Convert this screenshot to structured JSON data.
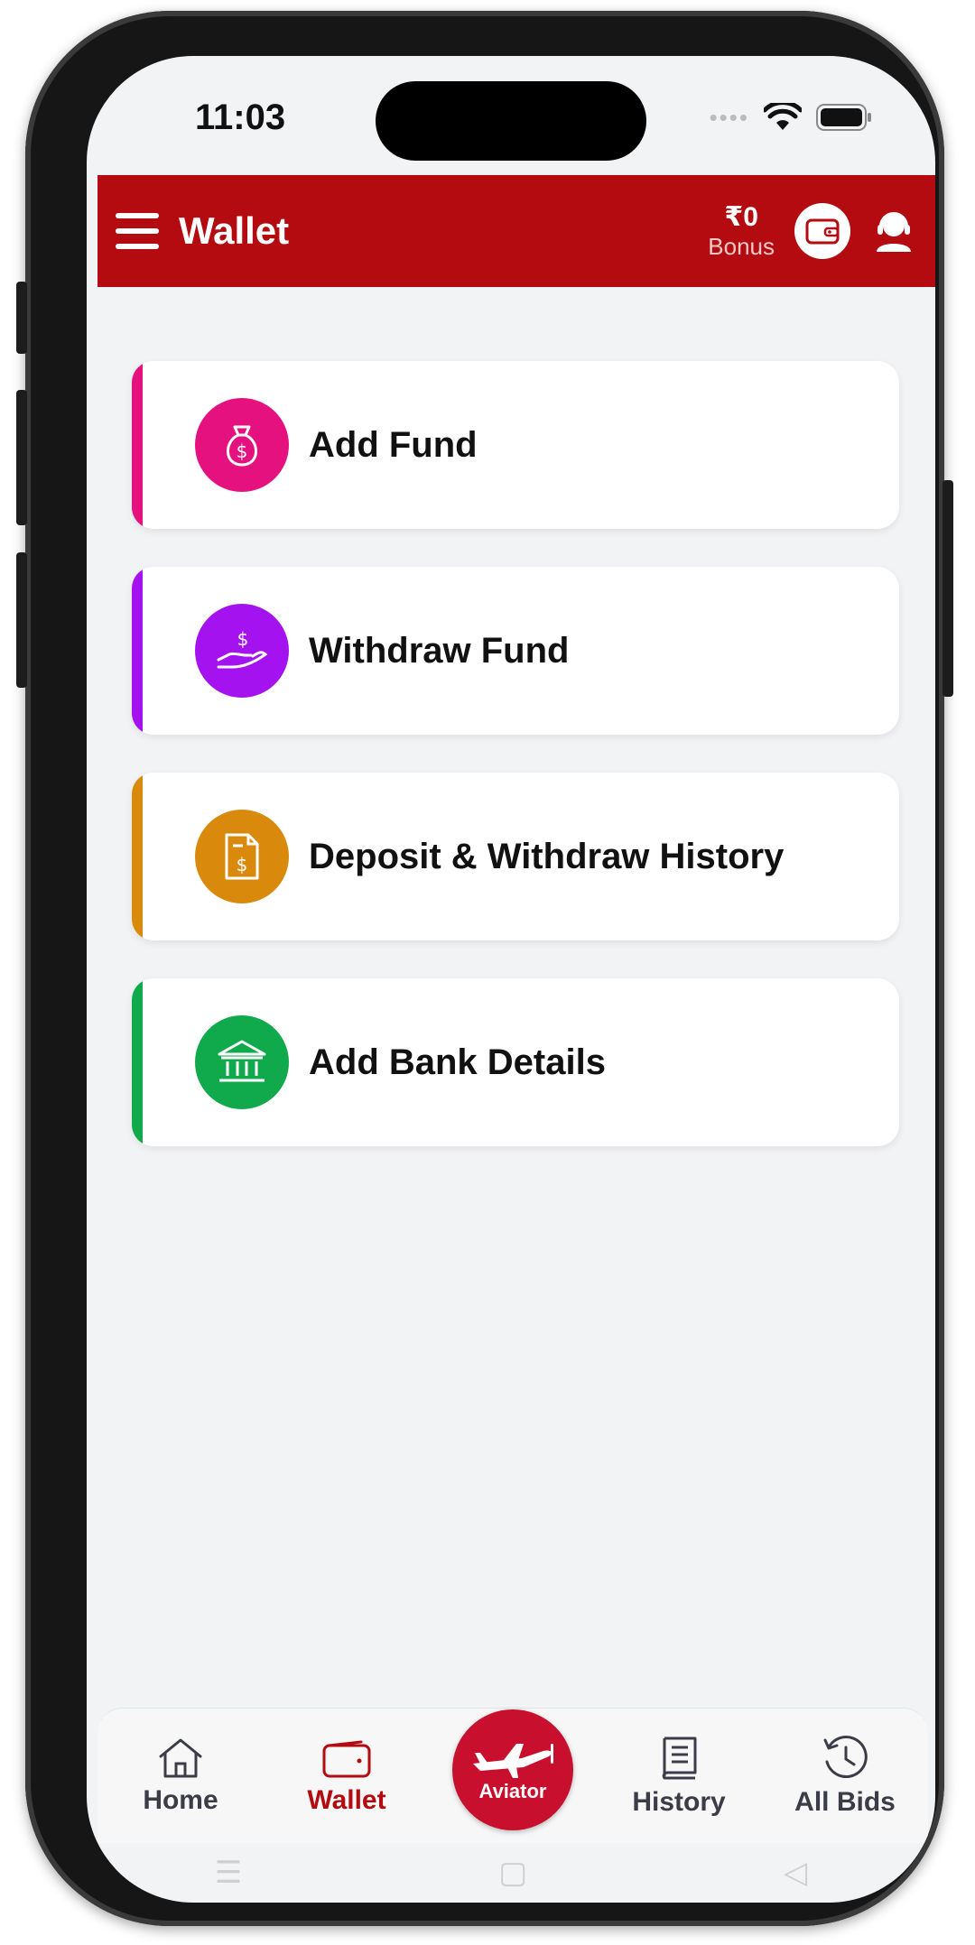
{
  "status_bar": {
    "time": "11:03",
    "dots": "••••"
  },
  "header": {
    "title": "Wallet",
    "bonus_amount": "₹0",
    "bonus_label": "Bonus"
  },
  "menu": [
    {
      "label": "Add Fund",
      "icon": "money-bag-icon",
      "color": "#e5117e"
    },
    {
      "label": "Withdraw Fund",
      "icon": "hand-dollar-icon",
      "color": "#a412f0"
    },
    {
      "label": "Deposit & Withdraw History",
      "icon": "document-dollar-icon",
      "color": "#d98a0c"
    },
    {
      "label": "Add Bank Details",
      "icon": "bank-icon",
      "color": "#10a94c"
    }
  ],
  "bottom_nav": {
    "home": "Home",
    "wallet": "Wallet",
    "aviator": "Aviator",
    "history": "History",
    "all_bids": "All Bids"
  },
  "colors": {
    "brand": "#b30b0f",
    "active_tab": "#b30b0f",
    "aviator": "#c8102e"
  }
}
